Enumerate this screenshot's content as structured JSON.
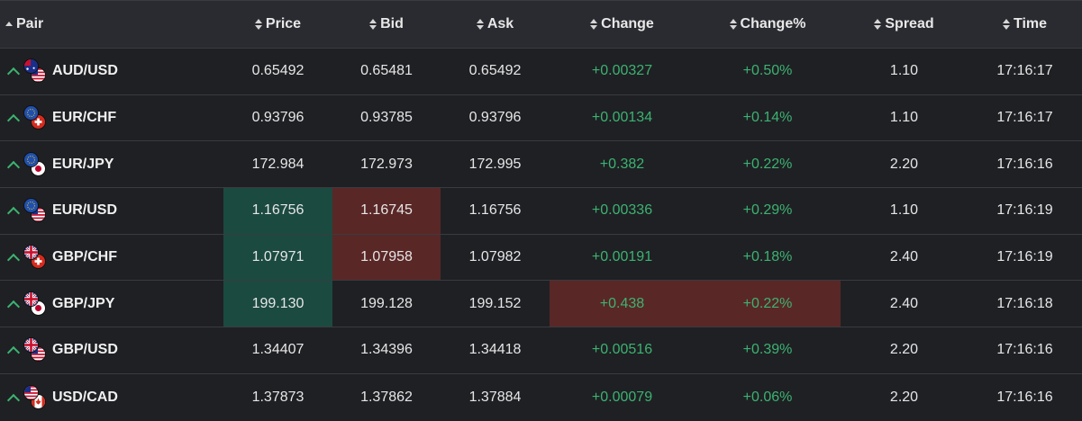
{
  "header": {
    "pair": "Pair",
    "price": "Price",
    "bid": "Bid",
    "ask": "Ask",
    "change": "Change",
    "change_pct": "Change%",
    "spread": "Spread",
    "time": "Time"
  },
  "colors": {
    "positive": "#3cb371",
    "highlight_up": "#1b4a41",
    "highlight_down": "#5a2727"
  },
  "rows": [
    {
      "pair": "AUD/USD",
      "base_flag": "australia-flag-icon",
      "quote_flag": "usa-flag-icon",
      "price": "0.65492",
      "bid": "0.65481",
      "ask": "0.65492",
      "change": "+0.00327",
      "change_pct": "+0.50%",
      "spread": "1.10",
      "time": "17:16:17"
    },
    {
      "pair": "EUR/CHF",
      "base_flag": "eu-flag-icon",
      "quote_flag": "switzerland-flag-icon",
      "price": "0.93796",
      "bid": "0.93785",
      "ask": "0.93796",
      "change": "+0.00134",
      "change_pct": "+0.14%",
      "spread": "1.10",
      "time": "17:16:17"
    },
    {
      "pair": "EUR/JPY",
      "base_flag": "eu-flag-icon",
      "quote_flag": "japan-flag-icon",
      "price": "172.984",
      "bid": "172.973",
      "ask": "172.995",
      "change": "+0.382",
      "change_pct": "+0.22%",
      "spread": "2.20",
      "time": "17:16:16"
    },
    {
      "pair": "EUR/USD",
      "base_flag": "eu-flag-icon",
      "quote_flag": "usa-flag-icon",
      "price": "1.16756",
      "bid": "1.16745",
      "ask": "1.16756",
      "change": "+0.00336",
      "change_pct": "+0.29%",
      "spread": "1.10",
      "time": "17:16:19"
    },
    {
      "pair": "GBP/CHF",
      "base_flag": "uk-flag-icon",
      "quote_flag": "switzerland-flag-icon",
      "price": "1.07971",
      "bid": "1.07958",
      "ask": "1.07982",
      "change": "+0.00191",
      "change_pct": "+0.18%",
      "spread": "2.40",
      "time": "17:16:19"
    },
    {
      "pair": "GBP/JPY",
      "base_flag": "uk-flag-icon",
      "quote_flag": "japan-flag-icon",
      "price": "199.130",
      "bid": "199.128",
      "ask": "199.152",
      "change": "+0.438",
      "change_pct": "+0.22%",
      "spread": "2.40",
      "time": "17:16:18"
    },
    {
      "pair": "GBP/USD",
      "base_flag": "uk-flag-icon",
      "quote_flag": "usa-flag-icon",
      "price": "1.34407",
      "bid": "1.34396",
      "ask": "1.34418",
      "change": "+0.00516",
      "change_pct": "+0.39%",
      "spread": "2.20",
      "time": "17:16:16"
    },
    {
      "pair": "USD/CAD",
      "base_flag": "usa-flag-icon",
      "quote_flag": "canada-flag-icon",
      "price": "1.37873",
      "bid": "1.37862",
      "ask": "1.37884",
      "change": "+0.00079",
      "change_pct": "+0.06%",
      "spread": "2.20",
      "time": "17:16:16"
    }
  ]
}
